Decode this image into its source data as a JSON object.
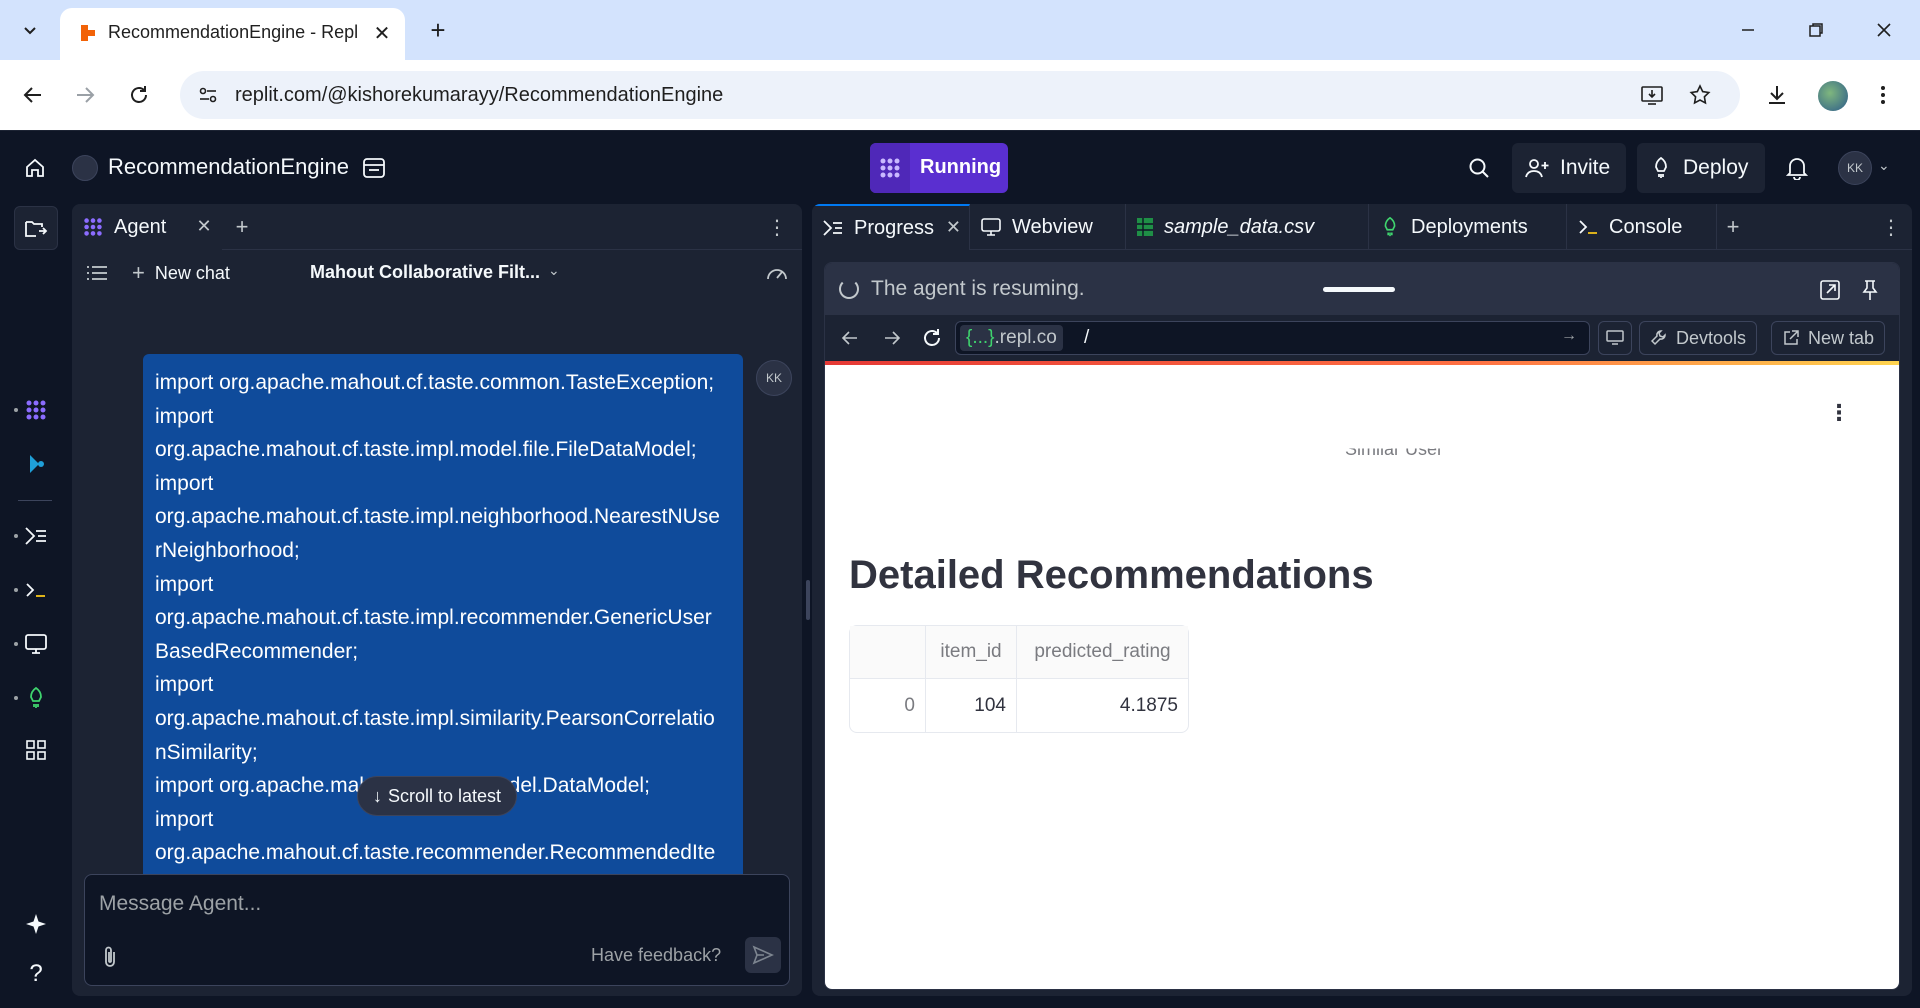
{
  "browser": {
    "tab_title": "RecommendationEngine - Replit",
    "url": "replit.com/@kishorekumarayy/RecommendationEngine"
  },
  "header": {
    "repl_name": "RecommendationEngine",
    "run_label": "Running",
    "invite_label": "Invite",
    "deploy_label": "Deploy",
    "user_initials": "KK"
  },
  "agent": {
    "tab_label": "Agent",
    "new_chat_label": "New chat",
    "chat_title": "Mahout Collaborative Filt...",
    "message_lines": [
      "import org.apache.mahout.cf.taste.common.TasteException;",
      "import",
      "org.apache.mahout.cf.taste.impl.model.file.FileDataModel;",
      "import",
      "org.apache.mahout.cf.taste.impl.neighborhood.NearestNUse",
      "rNeighborhood;",
      "import",
      "org.apache.mahout.cf.taste.impl.recommender.GenericUser",
      "BasedRecommender;",
      "import",
      "org.apache.mahout.cf.taste.impl.similarity.PearsonCorrelatio",
      "nSimilarity;",
      "import org.apache.mahout.cf.taste.model.DataModel;",
      "import",
      "org.apache.mahout.cf.taste.recommender.RecommendedIte"
    ],
    "scroll_latest_label": "Scroll to latest",
    "composer_placeholder": "Message Agent...",
    "feedback_label": "Have feedback?"
  },
  "right_tabs": [
    {
      "label": "Progress"
    },
    {
      "label": "Webview"
    },
    {
      "label": "sample_data.csv"
    },
    {
      "label": "Deployments"
    },
    {
      "label": "Console"
    }
  ],
  "progress": {
    "status_text": "The agent is resuming."
  },
  "webview": {
    "host_prefix": "{...}",
    "host_domain": ".repl.co",
    "path": "/",
    "devtools_label": "Devtools",
    "newtab_label": "New tab"
  },
  "app": {
    "caption": "Similar User",
    "heading": "Detailed Recommendations",
    "table": {
      "columns": [
        "",
        "item_id",
        "predicted_rating"
      ],
      "rows": [
        [
          "0",
          "104",
          "4.1875"
        ]
      ]
    }
  },
  "colors": {
    "run_purple": "#5a2fd0",
    "user_bubble": "#0f4b9b",
    "replit_dark": "#0e1525",
    "panel": "#1c2333"
  }
}
